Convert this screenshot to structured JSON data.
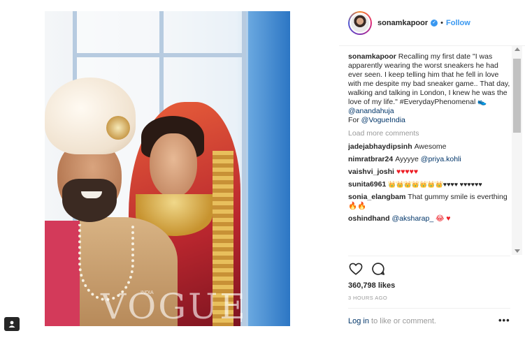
{
  "post": {
    "photo_watermark": "VOGUE",
    "photo_watermark_sub": "INDIA"
  },
  "header": {
    "username": "sonamkapoor",
    "verified_icon": "verified-badge-icon",
    "separator": "•",
    "follow_label": "Follow"
  },
  "caption": {
    "username": "sonamkapoor",
    "text": "Recalling my first date \"I was apparently wearing the worst sneakers he had ever seen. I keep telling him that he fell in love with me despite my bad sneaker game.. That day, walking and talking in London, I knew he was the love of my life.\" #EverydayPhenomenal 👟",
    "mention": "@anandahuja",
    "for_prefix": "For ",
    "for_mention": "@VogueIndia"
  },
  "load_more_label": "Load more comments",
  "comments": [
    {
      "user": "jadejabhaydipsinh",
      "text": "Awesome"
    },
    {
      "user": "nimratbrar24",
      "text": "Ayyyye ",
      "mention": "@priya.kohli"
    },
    {
      "user": "vaishvi_joshi",
      "text": "",
      "hearts": "♥♥♥♥♥"
    },
    {
      "user": "sunita6961",
      "text": "👑👑👑👑👑👑👑♥♥♥♥ ♥♥♥♥♥♥"
    },
    {
      "user": "sonia_elangbam",
      "text": "That gummy smile is everthing🔥🔥"
    },
    {
      "user": "oshindhand",
      "text": "",
      "mention": "@aksharap_",
      "trail": " 😂 ♥"
    }
  ],
  "actions": {
    "like_icon": "heart-icon",
    "comment_icon": "comment-bubble-icon"
  },
  "likes_label": "360,798 likes",
  "timestamp": "3 HOURS AGO",
  "login": {
    "link": "Log in",
    "suffix": " to like or comment."
  },
  "more_options": "•••",
  "colors": {
    "accent_blue": "#3897f0",
    "mention_blue": "#003569",
    "muted": "#999999",
    "heart_red": "#ed1c24"
  }
}
